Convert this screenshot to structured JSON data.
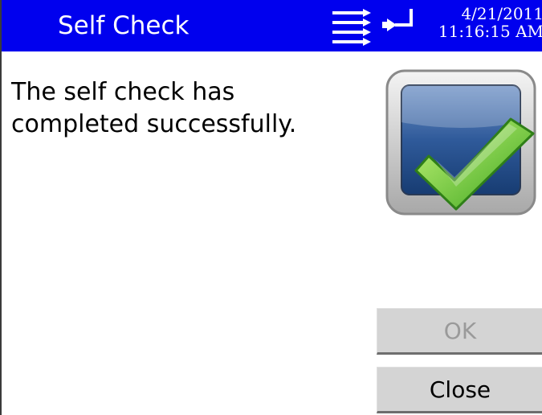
{
  "header": {
    "title": "Self Check",
    "date": "4/21/2011",
    "time": "11:16:15 AM",
    "background_color": "#0000ee"
  },
  "icons": {
    "menu": "hamburger-arrows-icon",
    "enter": "enter-icon",
    "status": "checkmark-monitor-icon"
  },
  "message": {
    "line1": "The self check has",
    "line2": "completed successfully."
  },
  "buttons": {
    "ok_label": "OK",
    "ok_enabled": false,
    "close_label": "Close"
  }
}
